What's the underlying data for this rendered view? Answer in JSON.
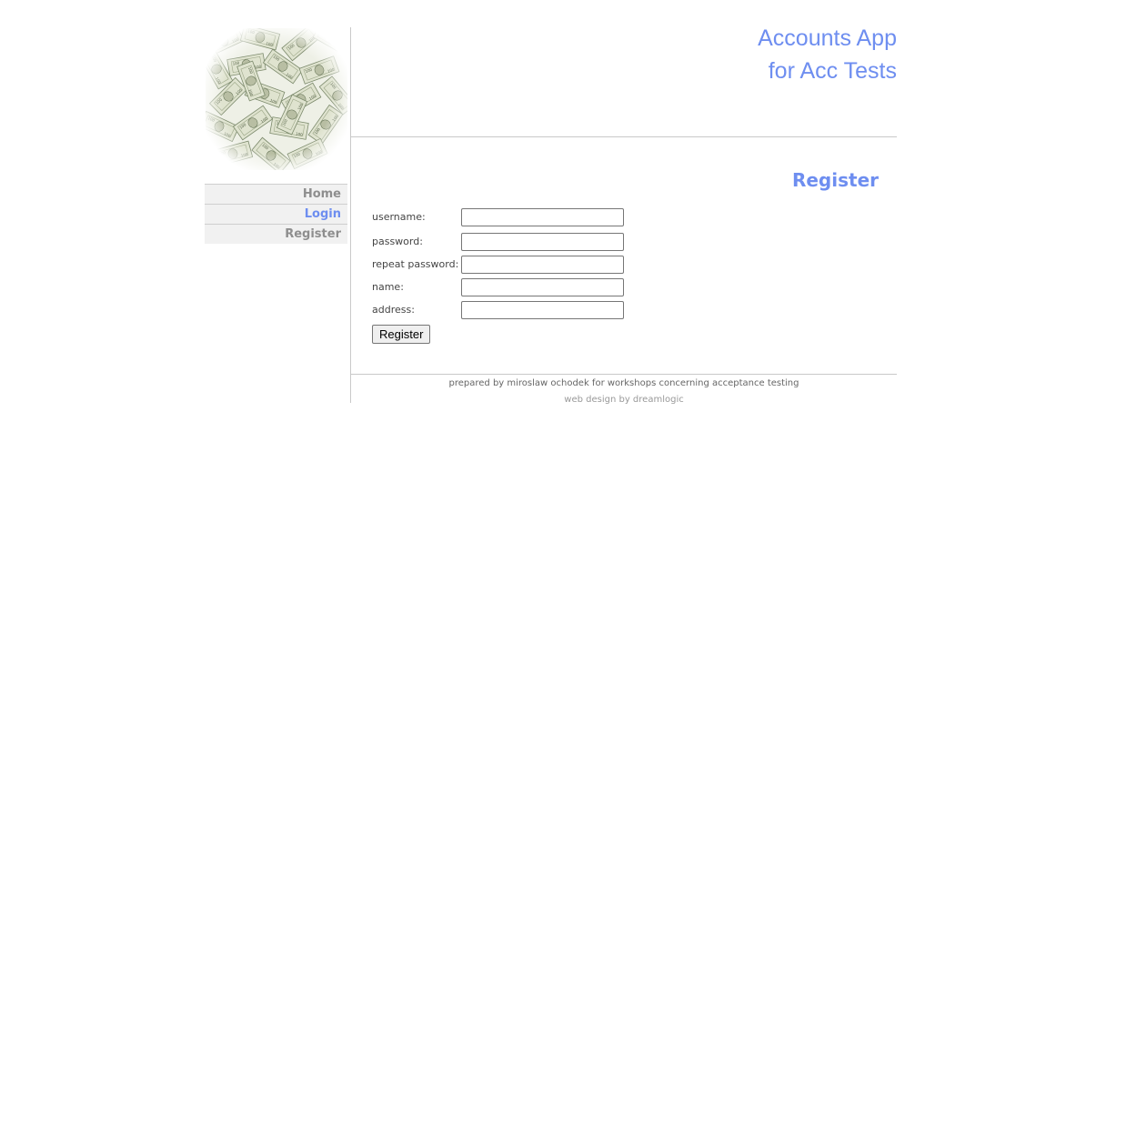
{
  "header": {
    "title_line1": "Accounts App",
    "title_line2": "for Acc Tests"
  },
  "banner": {
    "icon": "money-bills-image"
  },
  "nav": {
    "items": [
      {
        "label": "Home",
        "active": false
      },
      {
        "label": "Login",
        "active": true
      },
      {
        "label": "Register",
        "active": false
      }
    ]
  },
  "form": {
    "heading": "Register",
    "fields": [
      {
        "label": "username:",
        "value": ""
      },
      {
        "label": "password:",
        "value": ""
      },
      {
        "label": "repeat password:",
        "value": ""
      },
      {
        "label": "name:",
        "value": ""
      },
      {
        "label": "address:",
        "value": ""
      }
    ],
    "submit_label": "Register"
  },
  "footer": {
    "line1": "prepared by miroslaw ochodek for workshops concerning acceptance testing",
    "line2": "web design by dreamlogic"
  },
  "colors": {
    "accent": "#6e8ef0",
    "nav_text": "#8e8e8e",
    "nav_bg": "#f1f1f1"
  }
}
